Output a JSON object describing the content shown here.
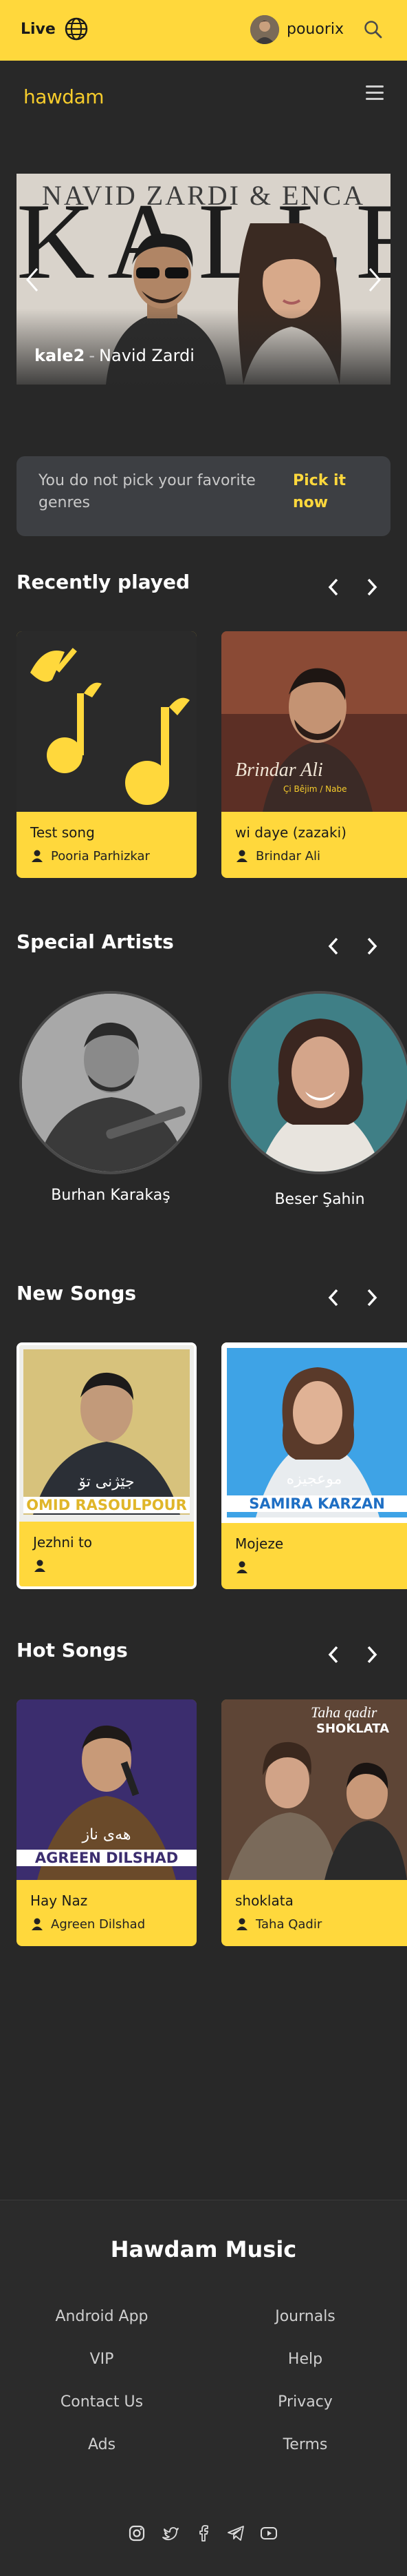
{
  "topbar": {
    "live_label": "Live",
    "username": "pouorix",
    "globe_icon": "globe-icon",
    "search_icon": "search-icon",
    "accent": "#ffd83c"
  },
  "header": {
    "logo": "hawdam",
    "menu_icon": "hamburger-menu-icon"
  },
  "hero": {
    "top_text": "NAVID ZARDI & ENCA",
    "big_text": "KALLE",
    "song": "kale2",
    "separator": "-",
    "artist": "Navid Zardi"
  },
  "genre_prompt": {
    "text": "You do not pick your favorite genres",
    "link": "Pick it now"
  },
  "recently_played": {
    "title": "Recently played",
    "cards": [
      {
        "title": "Test song",
        "artist": "Pooria Parhizkar"
      },
      {
        "title": "wi daye (zazaki)",
        "artist": "Brindar Ali",
        "cover_script": "Brindar Ali",
        "cover_sub": "Çi Bêjim / Nabe"
      }
    ]
  },
  "special_artists": {
    "title": "Special Artists",
    "artists": [
      {
        "name": "Burhan Karakaş"
      },
      {
        "name": "Beser Şahin"
      }
    ]
  },
  "new_songs": {
    "title": "New Songs",
    "cards": [
      {
        "title": "Jezhni to",
        "cover_caption": "OMID RASOULPOUR",
        "cover_script": "جێژنی تۆ"
      },
      {
        "title": "Mojeze",
        "cover_caption": "SAMIRA KARZAN",
        "cover_script": "موعجیزە"
      }
    ]
  },
  "hot_songs": {
    "title": "Hot Songs",
    "cards": [
      {
        "title": "Hay Naz",
        "artist": "Agreen Dilshad",
        "cover_caption": "AGREEN DILSHAD",
        "cover_script": "هەی ناز"
      },
      {
        "title": "shoklata",
        "artist": "Taha Qadir",
        "cover_caption": "SHOKLATA",
        "cover_script": "Taha qadir"
      }
    ]
  },
  "footer": {
    "title": "Hawdam Music",
    "links_left": [
      "Android App",
      "VIP",
      "Contact Us",
      "Ads"
    ],
    "links_right": [
      "Journals",
      "Help",
      "Privacy",
      "Terms"
    ],
    "social_icons": [
      "instagram-icon",
      "twitter-icon",
      "facebook-icon",
      "telegram-icon",
      "youtube-icon"
    ]
  }
}
